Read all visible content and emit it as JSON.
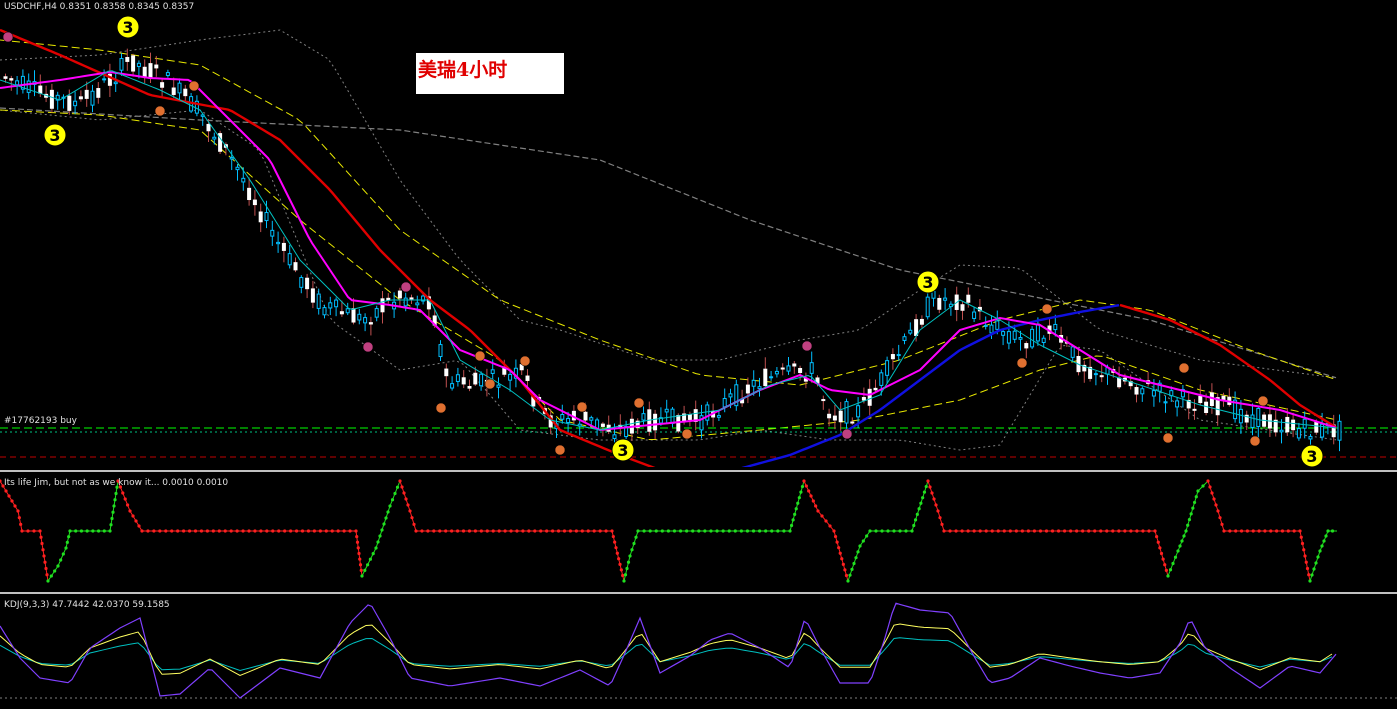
{
  "main": {
    "title": "USDCHF,H4  0.8351 0.8358 0.8345 0.8357",
    "overlay_title": "美瑞4小时",
    "order_label": "#17762193 buy",
    "markers": [
      {
        "text": "3",
        "color": "#ffff00"
      },
      {
        "text": "3",
        "color": "#ffff00"
      },
      {
        "text": "3",
        "color": "#ffff00"
      },
      {
        "text": "3",
        "color": "#ffff00"
      },
      {
        "text": "3",
        "color": "#ffff00"
      }
    ]
  },
  "jim": {
    "title": "Its life Jim, but not as we know it...  0.0010 0.0010"
  },
  "kdj": {
    "title": "KDJ(9,3,3) 47.7442 42.0370 59.1585"
  },
  "colors": {
    "background": "#000000",
    "bull": "#00bfff",
    "bear": "#ffffff",
    "ema_red": "#e00000",
    "ema_blue": "#1010e0",
    "ma_magenta": "#ff00ff",
    "ma_cyan": "#00c0c0",
    "band_yellow": "#e8e800",
    "band_gray": "#808080",
    "order_line": "#00ff00",
    "jim_red": "#ff2020",
    "jim_green": "#20e020",
    "kdj_k": "#8040ff",
    "kdj_d": "#ffff60",
    "kdj_j": "#00c0c0"
  }
}
